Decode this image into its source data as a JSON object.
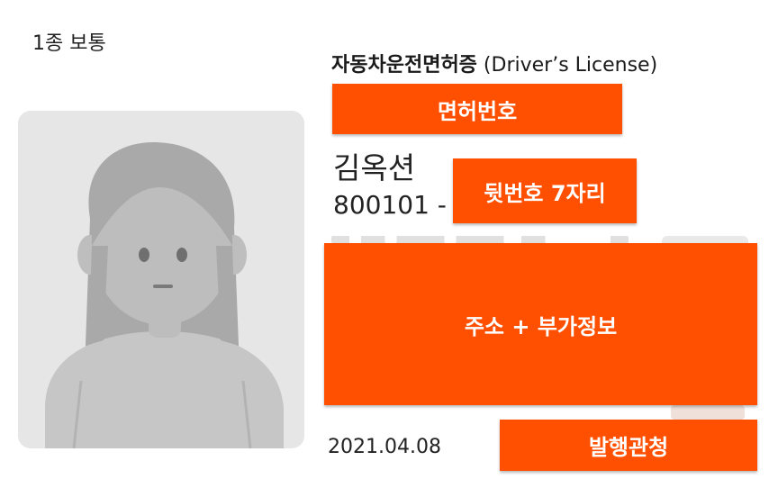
{
  "card": {
    "license_class": "1종 보통",
    "title_ko": "자동차운전면허증",
    "title_en": "(Driver’s License)",
    "name": "김옥션",
    "rrn_front": "800101 -",
    "issue_date": "2021.04.08"
  },
  "masks": {
    "license_number": "면허번호",
    "rrn_back": "뒷번호 7자리",
    "address_extra": "주소 + 부가정보",
    "issuer": "발행관청"
  },
  "colors": {
    "mask": "#ff4f00",
    "mask_text": "#ffffff",
    "photo_bg": "#e6e6e6"
  },
  "icons": {
    "photo": "person-silhouette-icon"
  }
}
